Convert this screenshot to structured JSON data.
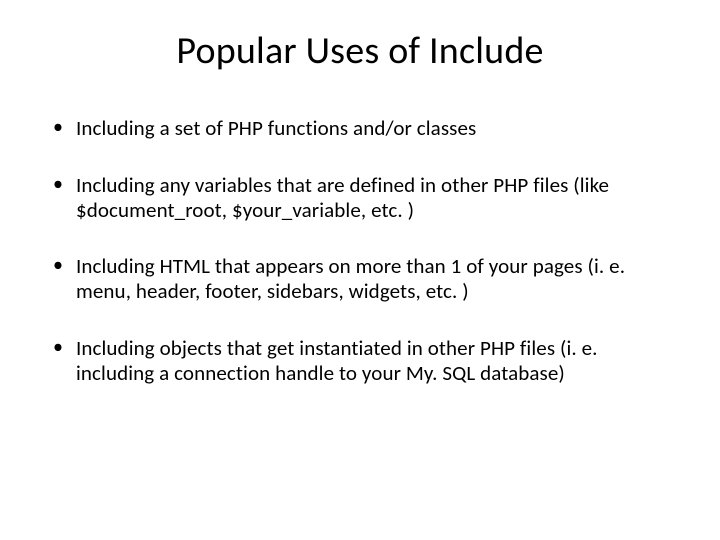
{
  "slide": {
    "title": "Popular Uses of Include",
    "bullets": [
      "Including a set of PHP functions and/or classes",
      "Including any variables that are defined in other PHP files (like $document_root, $your_variable, etc. )",
      "Including HTML that appears on more than 1 of your pages (i. e. menu, header, footer, sidebars, widgets, etc. )",
      "Including objects that get instantiated in other PHP files (i. e. including a connection handle to your My. SQL database)"
    ]
  }
}
